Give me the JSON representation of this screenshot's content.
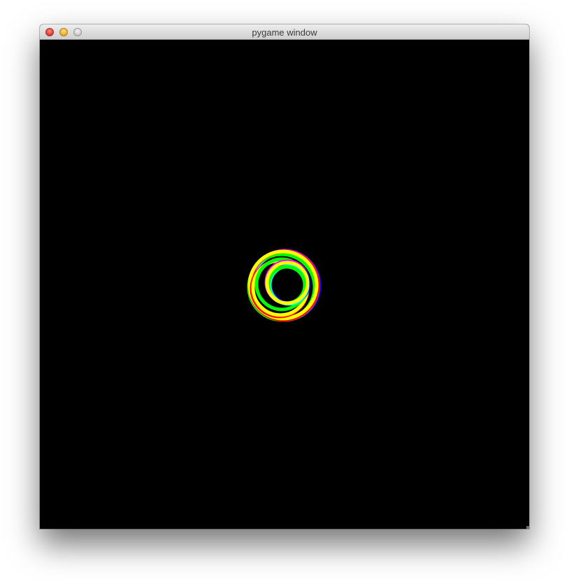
{
  "window": {
    "title": "pygame window",
    "controls": {
      "close_icon": "close-icon",
      "minimize_icon": "minimize-icon",
      "zoom_icon": "zoom-icon"
    }
  },
  "canvas": {
    "background": "#000000",
    "ring_colors": [
      "#ffff00",
      "#ff0000",
      "#ff00ff",
      "#0000ff",
      "#00ffff",
      "#00ff00"
    ]
  }
}
